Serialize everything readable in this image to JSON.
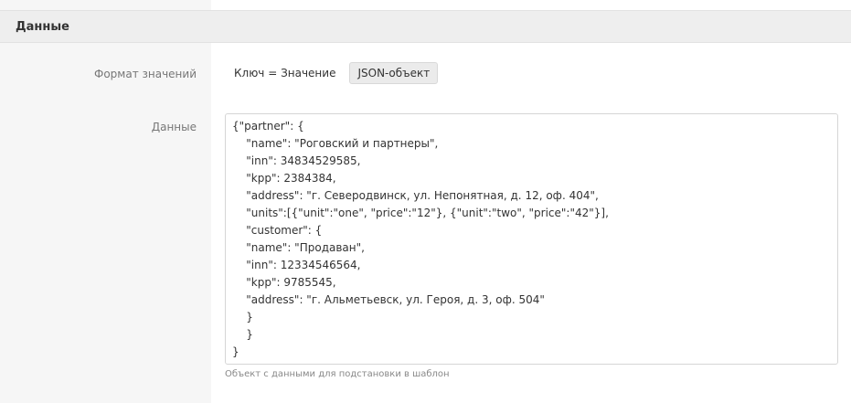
{
  "section": {
    "title": "Данные"
  },
  "fields": {
    "format": {
      "label": "Формат значений",
      "options": [
        "Ключ = Значение",
        "JSON-объект"
      ],
      "selected": "JSON-объект"
    },
    "data": {
      "label": "Данные",
      "lines": [
        "{\"partner\": {",
        "    \"name\": \"Роговский и партнеры\",",
        "    \"inn\": 34834529585,",
        "    \"kpp\": 2384384,",
        "    \"address\": \"г. Северодвинск, ул. Непонятная, д. 12, оф. 404\",",
        "    \"units\":[{\"unit\":\"one\", \"price\":\"12\"}, {\"unit\":\"two\", \"price\":\"42\"}],",
        "    \"customer\": {",
        "    \"name\": \"Продаван\",",
        "    \"inn\": 12334546564,",
        "    \"kpp\": 9785545,",
        "    \"address\": \"г. Альметьевск, ул. Героя, д. 3, оф. 504\"",
        "    }",
        "    }",
        "}"
      ],
      "hint": "Объект с данными для подстановки в шаблон"
    }
  }
}
